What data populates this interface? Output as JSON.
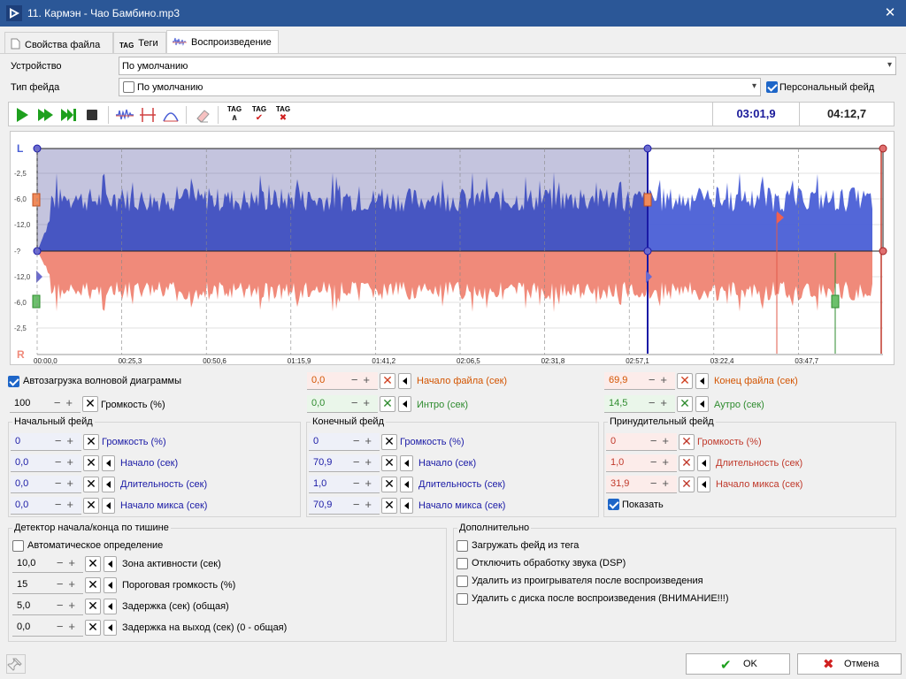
{
  "window": {
    "title": "11. Кармэн - Чао Бамбино.mp3",
    "close_glyph": "✕"
  },
  "tabs": [
    {
      "label": "Свойства файла",
      "icon": "document-icon"
    },
    {
      "label": "Теги",
      "icon": "tag-icon",
      "badge": "TAG"
    },
    {
      "label": "Воспроизведение",
      "icon": "waveform-icon"
    }
  ],
  "device": {
    "label": "Устройство",
    "value": "По умолчанию"
  },
  "fade_type": {
    "label": "Тип фейда",
    "value": "По умолчанию"
  },
  "personal_fade": {
    "label": "Персональный фейд",
    "checked": true
  },
  "toolbar": {
    "tag_badge": "TAG",
    "time_position": "03:01,9",
    "time_total": "04:12,7"
  },
  "waveform": {
    "channel_top": "L",
    "channel_bottom": "R",
    "db_labels": [
      "-2,5",
      "-6,0",
      "-12,0",
      "-?",
      "-12,0",
      "-6,0",
      "-2,5"
    ],
    "timeline": [
      "00:00,0",
      "00:25,3",
      "00:50,6",
      "01:15,9",
      "01:41,2",
      "02:06,5",
      "02:31,8",
      "02:57,1",
      "03:22,4",
      "03:47,7"
    ]
  },
  "autoload": {
    "label": "Автозагрузка волновой диаграммы",
    "checked": true
  },
  "volume": {
    "value": "100",
    "label": "Громкость (%)"
  },
  "file_start": {
    "value": "0,0",
    "label": "Начало файла (сек)"
  },
  "intro": {
    "value": "0,0",
    "label": "Интро (сек)"
  },
  "file_end": {
    "value": "69,9",
    "label": "Конец файла (сек)"
  },
  "outro": {
    "value": "14,5",
    "label": "Аутро (сек)"
  },
  "fade_in": {
    "title": "Начальный фейд",
    "rows": [
      {
        "value": "0",
        "label": "Громкость (%)"
      },
      {
        "value": "0,0",
        "label": "Начало (сек)"
      },
      {
        "value": "0,0",
        "label": "Длительность (сек)"
      },
      {
        "value": "0,0",
        "label": "Начало микса (сек)"
      }
    ]
  },
  "fade_out": {
    "title": "Конечный фейд",
    "rows": [
      {
        "value": "0",
        "label": "Громкость (%)"
      },
      {
        "value": "70,9",
        "label": "Начало (сек)"
      },
      {
        "value": "1,0",
        "label": "Длительность (сек)"
      },
      {
        "value": "70,9",
        "label": "Начало микса (сек)"
      }
    ]
  },
  "forced_fade": {
    "title": "Принудительный фейд",
    "rows": [
      {
        "value": "0",
        "label": "Громкость (%)"
      },
      {
        "value": "1,0",
        "label": "Длительность (сек)"
      },
      {
        "value": "31,9",
        "label": "Начало микса (сек)"
      }
    ],
    "show_label": "Показать",
    "show_checked": true
  },
  "silence": {
    "title": "Детектор начала/конца по тишине",
    "auto_label": "Автоматическое определение",
    "auto_checked": false,
    "rows": [
      {
        "value": "10,0",
        "label": "Зона активности (сек)"
      },
      {
        "value": "15",
        "label": "Пороговая громкость (%)"
      },
      {
        "value": "5,0",
        "label": "Задержка (сек) (общая)"
      },
      {
        "value": "0,0",
        "label": "Задержка на выход (сек) (0 - общая)"
      }
    ]
  },
  "extra": {
    "title": "Дополнительно",
    "options": [
      {
        "label": "Загружать фейд из тега",
        "checked": false
      },
      {
        "label": "Отключить обработку звука (DSP)",
        "checked": false
      },
      {
        "label": "Удалить из проигрывателя после воспроизведения",
        "checked": false
      },
      {
        "label": "Удалить с диска после воспроизведения (ВНИМАНИЕ!!!)",
        "checked": false
      }
    ]
  },
  "buttons": {
    "ok": "OK",
    "cancel": "Отмена"
  },
  "colors": {
    "fade_in": "#1a1aa6",
    "fade_out": "#1a1aa6",
    "forced": "#c0392b",
    "start_file": "#d35400",
    "intro": "#2e8b2e",
    "accent": "#1e66c8",
    "wave_top": "#4a5fd6",
    "wave_bottom": "#f08a7a"
  }
}
